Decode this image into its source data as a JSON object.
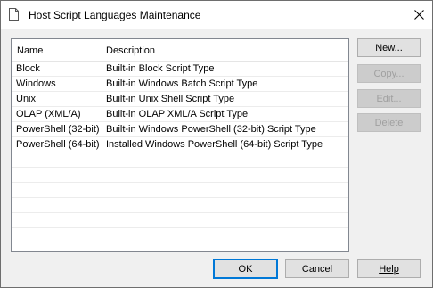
{
  "window": {
    "title": "Host Script Languages Maintenance",
    "icon": "document-icon",
    "close_glyph": "✕"
  },
  "list": {
    "columns": [
      "Name",
      "Description"
    ],
    "rows": [
      {
        "name": "Block",
        "description": "Built-in Block Script Type"
      },
      {
        "name": "Windows",
        "description": "Built-in Windows Batch Script Type"
      },
      {
        "name": "Unix",
        "description": "Built-in Unix Shell Script Type"
      },
      {
        "name": "OLAP (XML/A)",
        "description": "Built-in OLAP XML/A Script Type"
      },
      {
        "name": "PowerShell (32-bit)",
        "description": "Built-in Windows PowerShell (32-bit) Script Type"
      },
      {
        "name": "PowerShell (64-bit)",
        "description": "Installed Windows PowerShell (64-bit) Script Type"
      }
    ]
  },
  "side_buttons": {
    "new_label": "New...",
    "copy_label": "Copy...",
    "edit_label": "Edit...",
    "delete_label": "Delete"
  },
  "bottom_buttons": {
    "ok_label": "OK",
    "cancel_label": "Cancel",
    "help_label": "Help"
  },
  "colors": {
    "default_button_border": "#0078d7",
    "disabled_text": "#a0a0a0"
  }
}
